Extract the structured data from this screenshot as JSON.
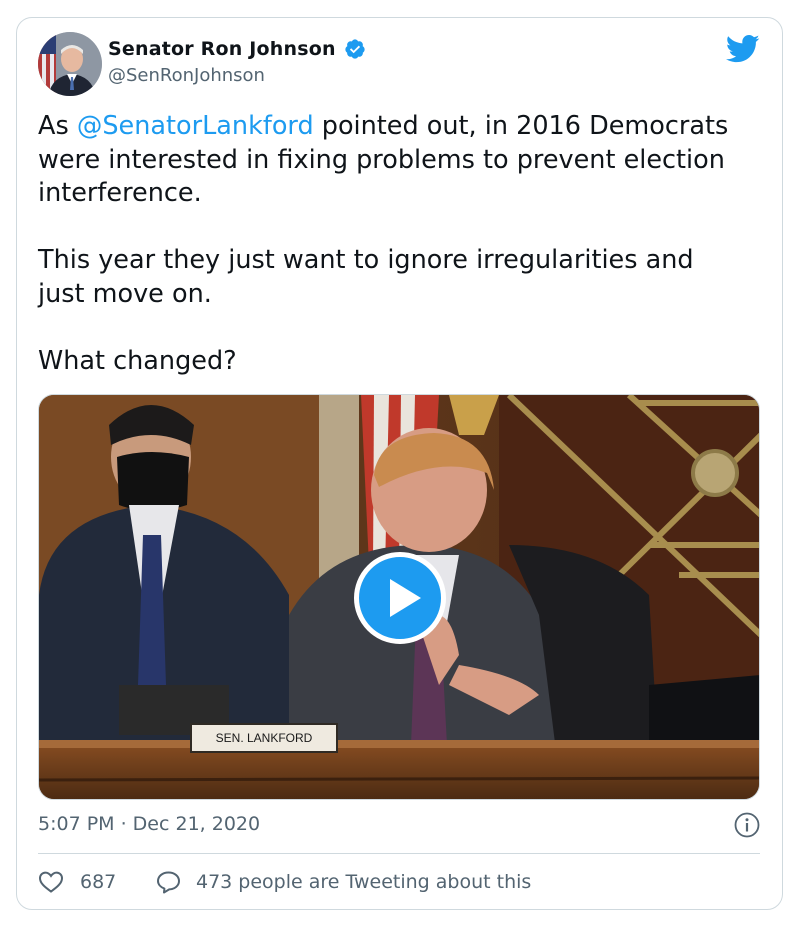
{
  "author": {
    "name": "Senator Ron Johnson",
    "handle": "@SenRonJohnson",
    "verified": true
  },
  "tweet": {
    "lines": [
      {
        "pre": "As ",
        "mention": "@SenatorLankford",
        "post": " pointed out, in 2016 Democrats"
      },
      "were interested in fixing problems to prevent election",
      "interference.",
      "This year they just want to ignore irregularities and",
      "just move on.",
      "What changed?"
    ]
  },
  "media": {
    "nameplate": "SEN. LANKFORD",
    "play_icon": "play-icon"
  },
  "meta": {
    "timestamp": "5:07 PM · Dec 21, 2020",
    "likes": "687",
    "conversation": "473 people are Tweeting about this"
  },
  "icons": {
    "brand": "twitter-bird-icon",
    "verified": "verified-badge-icon",
    "info": "info-icon",
    "like": "heart-icon",
    "reply": "speech-bubble-icon"
  },
  "colors": {
    "accent": "#1d9bf0",
    "text": "#0f1419",
    "secondary": "#536471",
    "border": "#cfd9de"
  }
}
